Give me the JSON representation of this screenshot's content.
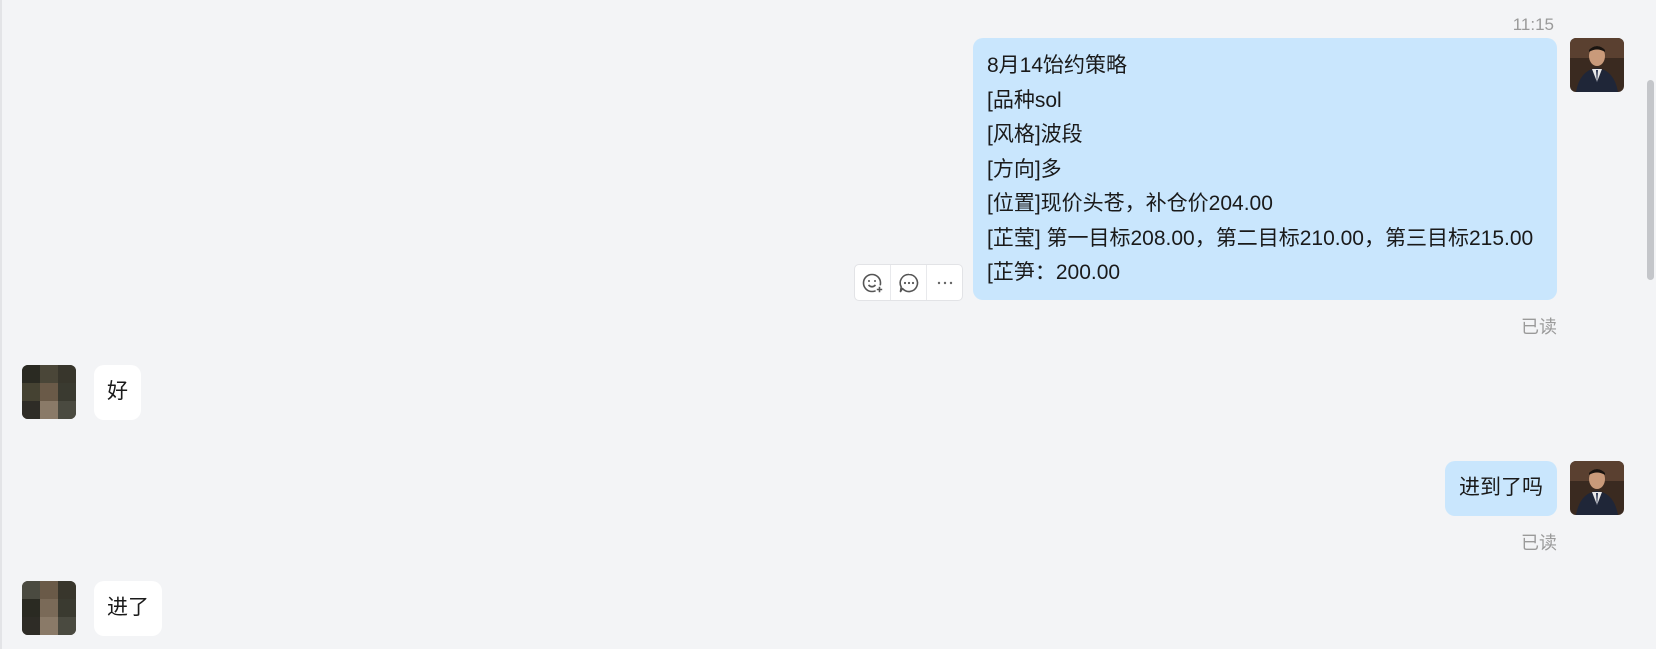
{
  "timestamp": "11:15",
  "strategy_message": {
    "lines": [
      "8月14饴约策略",
      "[品种sol",
      "[风格]波段",
      "[方向]多",
      "[位置]现价头苍，补仓价204.00",
      "[芷莹] 第一目标208.00，第二目标210.00，第三目标215.00",
      "[芷笋：200.00"
    ]
  },
  "read_status_1": "已读",
  "reply_1": "好",
  "question": "进到了吗",
  "read_status_2": "已读",
  "reply_2": "进了",
  "icons": {
    "add_emoji": "emoji-plus-icon",
    "quote": "comment-icon",
    "more": "ellipsis-icon"
  },
  "colors": {
    "background": "#f3f4f6",
    "my_bubble": "#c9e6fd",
    "other_bubble": "#ffffff",
    "meta_text": "#9a9a9a"
  }
}
